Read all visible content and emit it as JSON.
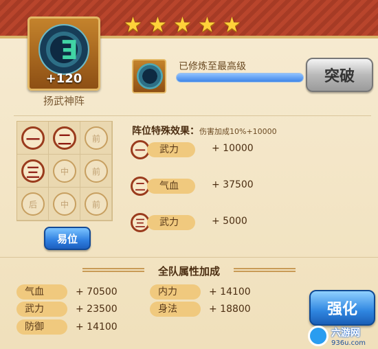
{
  "header": {
    "stars": 5
  },
  "formation": {
    "count": "+120",
    "name": "扬武神阵"
  },
  "breakthrough": {
    "status": "已修炼至最高级",
    "progress": 1.0,
    "button": "突破"
  },
  "grid": {
    "cells": [
      {
        "label": "一",
        "active": true
      },
      {
        "label": "二",
        "active": true
      },
      {
        "label": "前",
        "active": false
      },
      {
        "label": "三",
        "active": true
      },
      {
        "label": "中",
        "active": false
      },
      {
        "label": "前",
        "active": false
      },
      {
        "label": "后",
        "active": false
      },
      {
        "label": "中",
        "active": false
      },
      {
        "label": "前",
        "active": false
      }
    ],
    "swap_button": "易位"
  },
  "special": {
    "title": "阵位特殊效果：",
    "subtitle": "伤害加成10%+10000",
    "rows": [
      {
        "num": "一",
        "stat": "武力",
        "value": "+ 10000"
      },
      {
        "num": "二",
        "stat": "气血",
        "value": "+ 37500"
      },
      {
        "num": "三",
        "stat": "武力",
        "value": "+ 5000"
      }
    ]
  },
  "team": {
    "title": "全队属性加成",
    "attrs": [
      {
        "stat": "气血",
        "value": "+ 70500"
      },
      {
        "stat": "武力",
        "value": "+ 23500"
      },
      {
        "stat": "防御",
        "value": "+ 14100"
      },
      {
        "stat": "内力",
        "value": "+ 14100"
      },
      {
        "stat": "身法",
        "value": "+ 18800"
      }
    ],
    "strengthen_button": "强化"
  },
  "watermark": {
    "text": "六游网",
    "sub": "936u.com"
  },
  "colors": {
    "accent": "#3f86e7",
    "pill": "#f0c97e",
    "badge": "#9a3b1d"
  },
  "icons": {
    "star": "star-icon",
    "formation": "formation-disc-icon"
  }
}
